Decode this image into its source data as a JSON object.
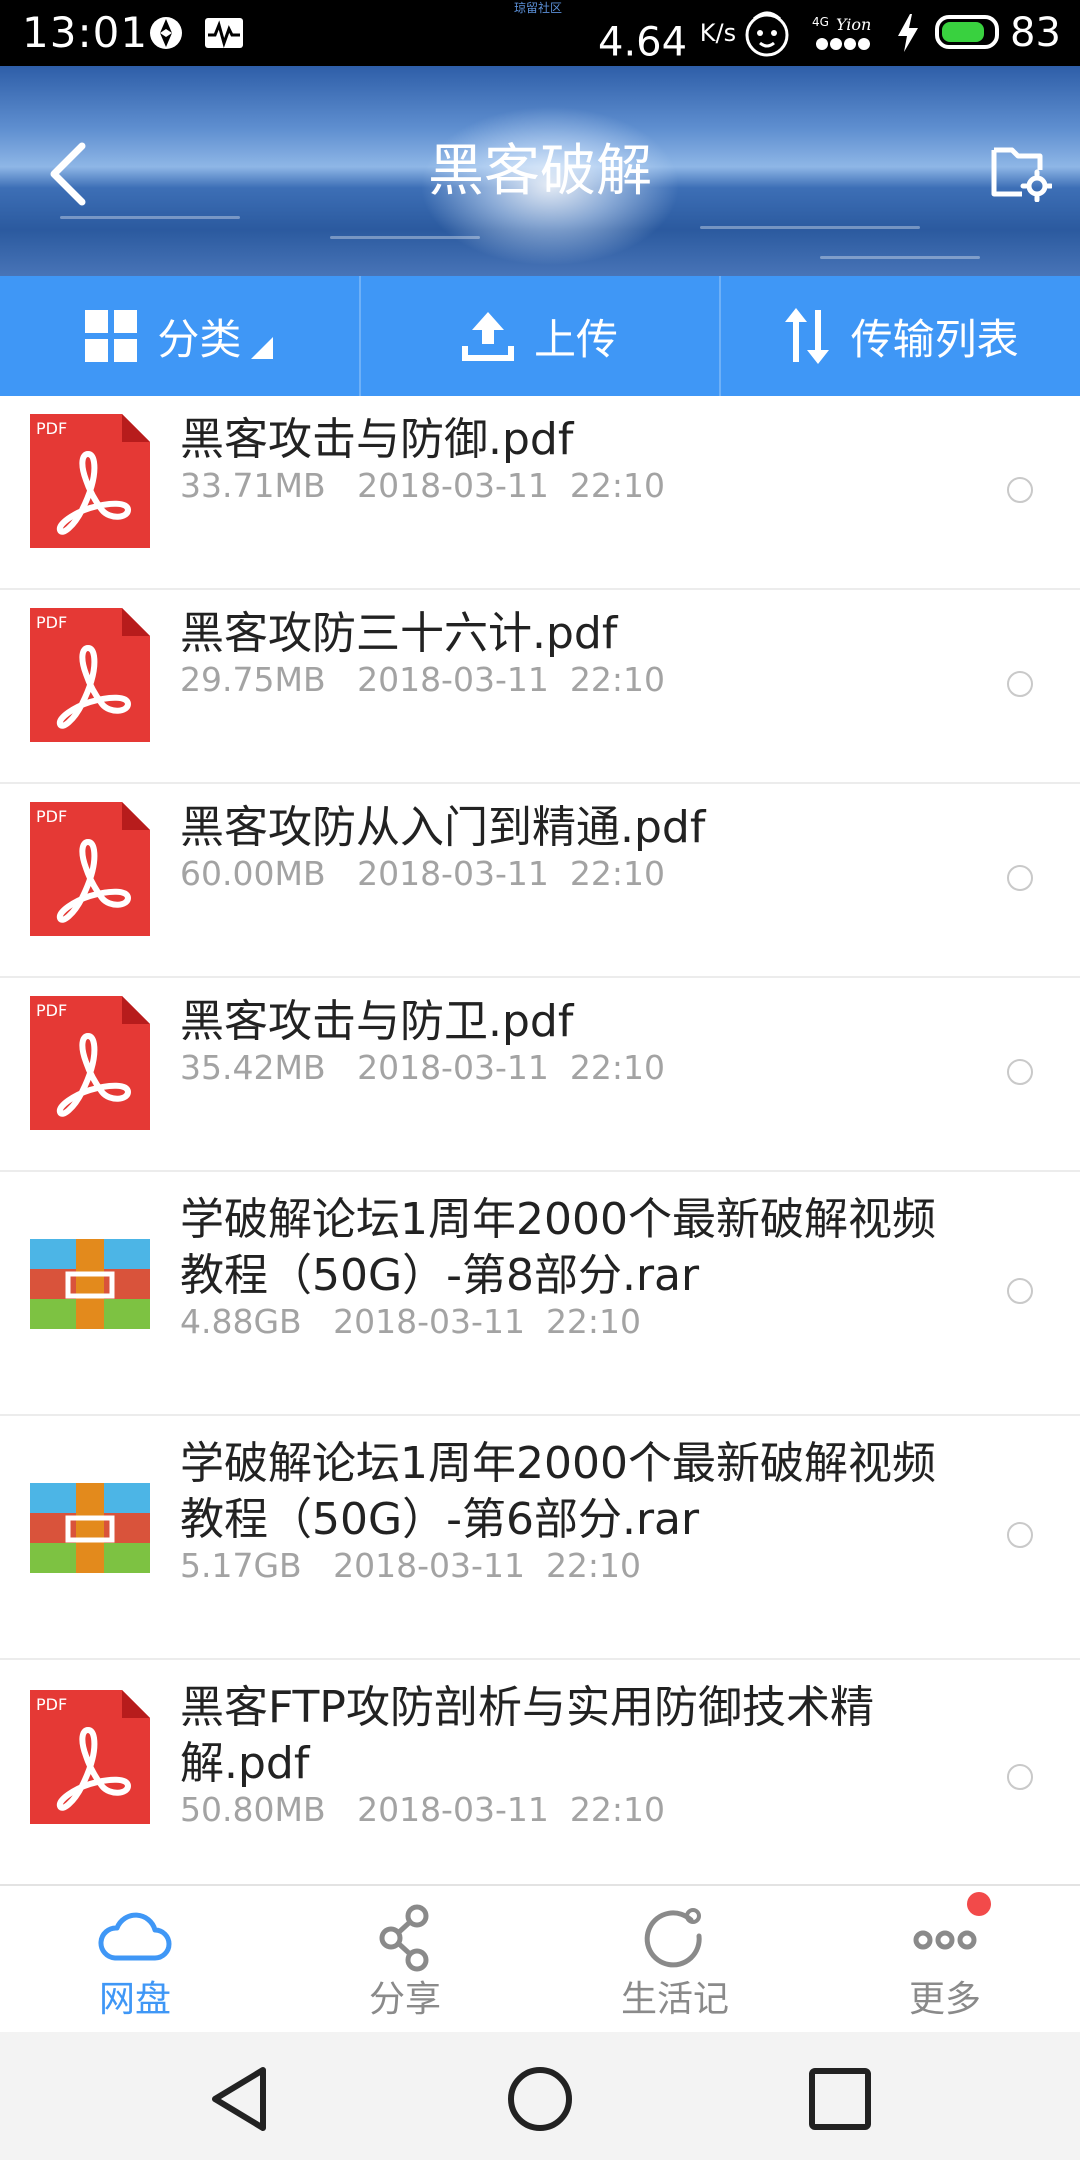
{
  "status_bar": {
    "time": "13:01",
    "top_note": "琼留社区",
    "speed": "4.64",
    "speed_unit": "K/s",
    "network": "4G",
    "battery": "83",
    "battery_fraction": 0.83,
    "battery_color": "#39d13f"
  },
  "header": {
    "title": "黑客破解",
    "back_icon": "chevron-left-icon",
    "settings_icon": "folder-settings-icon"
  },
  "actions": {
    "category": "分类",
    "upload": "上传",
    "transfer": "传输列表",
    "color": "#3f97f6"
  },
  "files": [
    {
      "name": "黑客攻击与防御.pdf",
      "size": "33.71MB",
      "date": "2018-03-11",
      "time": "22:10",
      "type": "pdf"
    },
    {
      "name": "黑客攻防三十六计.pdf",
      "size": "29.75MB",
      "date": "2018-03-11",
      "time": "22:10",
      "type": "pdf"
    },
    {
      "name": "黑客攻防从入门到精通.pdf",
      "size": "60.00MB",
      "date": "2018-03-11",
      "time": "22:10",
      "type": "pdf"
    },
    {
      "name": "黑客攻击与防卫.pdf",
      "size": "35.42MB",
      "date": "2018-03-11",
      "time": "22:10",
      "type": "pdf"
    },
    {
      "name": "学破解论坛1周年2000个最新破解视频教程（50G）-第8部分.rar",
      "size": "4.88GB",
      "date": "2018-03-11",
      "time": "22:10",
      "type": "rar"
    },
    {
      "name": "学破解论坛1周年2000个最新破解视频教程（50G）-第6部分.rar",
      "size": "5.17GB",
      "date": "2018-03-11",
      "time": "22:10",
      "type": "rar"
    },
    {
      "name": "黑客FTP攻防剖析与实用防御技术精解.pdf",
      "size": "50.80MB",
      "date": "2018-03-11",
      "time": "22:10",
      "type": "pdf"
    }
  ],
  "pdf_badge": "PDF",
  "bottom_nav": [
    {
      "label": "网盘",
      "icon": "cloud-icon",
      "active": true
    },
    {
      "label": "分享",
      "icon": "share-icon",
      "active": false
    },
    {
      "label": "生活记",
      "icon": "moment-icon",
      "active": false
    },
    {
      "label": "更多",
      "icon": "more-icon",
      "active": false,
      "badge": true
    }
  ],
  "colors": {
    "accent": "#3f97f6",
    "pdf_red": "#e53935",
    "badge_red": "#f24a4a"
  }
}
